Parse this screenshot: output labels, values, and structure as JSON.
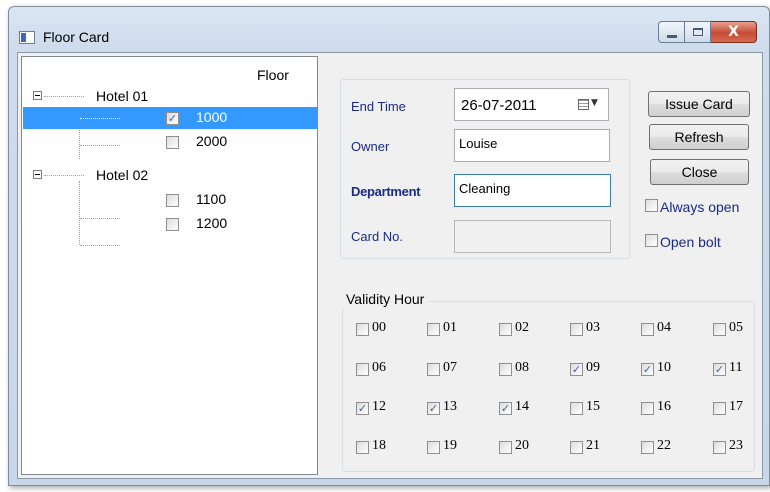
{
  "window": {
    "title": "Floor Card",
    "caption": {
      "minimize": "_",
      "maximize": "□",
      "close": "X"
    }
  },
  "tree": {
    "header": "Floor",
    "hotels": [
      {
        "label": "Hotel 01",
        "expanded": true,
        "floors": [
          {
            "label": "1000",
            "checked": true,
            "selected": true
          },
          {
            "label": "2000",
            "checked": false,
            "selected": false
          }
        ]
      },
      {
        "label": "Hotel 02",
        "expanded": true,
        "floors": [
          {
            "label": "1100",
            "checked": false,
            "selected": false
          },
          {
            "label": "1200",
            "checked": false,
            "selected": false
          }
        ]
      }
    ]
  },
  "form": {
    "end_time_label": "End Time",
    "end_time_value": "26-07-2011",
    "owner_label": "Owner",
    "owner_value": "Louise",
    "department_label": "Department",
    "department_value": "Cleaning",
    "card_no_label": "Card No.",
    "card_no_value": ""
  },
  "buttons": {
    "issue_card": "Issue Card",
    "refresh": "Refresh",
    "close": "Close"
  },
  "options": {
    "always_open": {
      "label": "Always open",
      "checked": false
    },
    "open_bolt": {
      "label": "Open bolt",
      "checked": false
    }
  },
  "validity": {
    "title": "Validity Hour",
    "hours": [
      {
        "label": "00",
        "checked": false
      },
      {
        "label": "01",
        "checked": false
      },
      {
        "label": "02",
        "checked": false
      },
      {
        "label": "03",
        "checked": false
      },
      {
        "label": "04",
        "checked": false
      },
      {
        "label": "05",
        "checked": false
      },
      {
        "label": "06",
        "checked": false
      },
      {
        "label": "07",
        "checked": false
      },
      {
        "label": "08",
        "checked": false
      },
      {
        "label": "09",
        "checked": true
      },
      {
        "label": "10",
        "checked": true
      },
      {
        "label": "11",
        "checked": true
      },
      {
        "label": "12",
        "checked": true
      },
      {
        "label": "13",
        "checked": true
      },
      {
        "label": "14",
        "checked": true
      },
      {
        "label": "15",
        "checked": false
      },
      {
        "label": "16",
        "checked": false
      },
      {
        "label": "17",
        "checked": false
      },
      {
        "label": "18",
        "checked": false
      },
      {
        "label": "19",
        "checked": false
      },
      {
        "label": "20",
        "checked": false
      },
      {
        "label": "21",
        "checked": false
      },
      {
        "label": "22",
        "checked": false
      },
      {
        "label": "23",
        "checked": false
      }
    ]
  },
  "colors": {
    "selection": "#3399ff",
    "label_blue": "#1a2a8a",
    "close_button": "#c64b33"
  }
}
